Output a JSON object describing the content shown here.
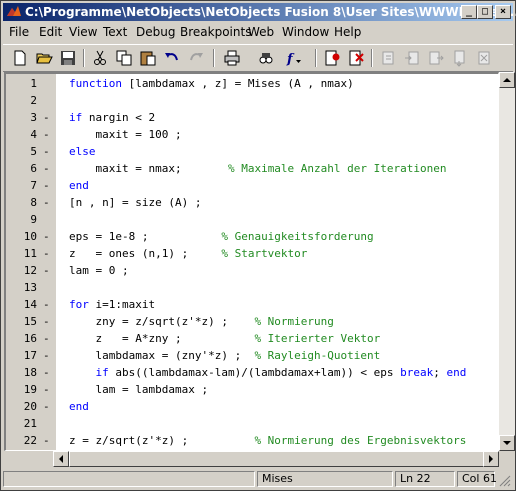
{
  "window": {
    "title": "C:\\Programme\\NetObjects\\NetObjects Fusion 8\\User Sites\\WWWErgVert...",
    "controls": [
      "_",
      "□",
      "×"
    ]
  },
  "menu": [
    "File",
    "Edit",
    "View",
    "Text",
    "Debug",
    "Breakpoints",
    "Web",
    "Window",
    "Help"
  ],
  "toolbar": [
    "new-icon",
    "open-icon",
    "save-icon",
    "cut-icon",
    "copy-icon",
    "paste-icon",
    "undo-icon",
    "redo-icon",
    "print-icon",
    "find-icon",
    "function-icon",
    "set-breakpoint-icon",
    "clear-breakpoints-icon",
    "step-icon",
    "step-in-icon",
    "step-out-icon",
    "continue-icon",
    "exit-debug-icon"
  ],
  "editor": {
    "lines": [
      {
        "n": "1",
        "dash": "",
        "segs": [
          [
            "kw",
            "function"
          ],
          [
            "tx",
            " [lambdamax , z] = Mises (A , nmax)"
          ]
        ]
      },
      {
        "n": "2",
        "dash": "",
        "segs": []
      },
      {
        "n": "3",
        "dash": "-",
        "segs": [
          [
            "kw",
            "if"
          ],
          [
            "tx",
            " nargin < 2"
          ]
        ]
      },
      {
        "n": "4",
        "dash": "-",
        "segs": [
          [
            "tx",
            "    maxit = 100 ;"
          ]
        ]
      },
      {
        "n": "5",
        "dash": "-",
        "segs": [
          [
            "kw",
            "else"
          ]
        ]
      },
      {
        "n": "6",
        "dash": "-",
        "segs": [
          [
            "tx",
            "    maxit = nmax;       "
          ],
          [
            "cm",
            "% Maximale Anzahl der Iterationen"
          ]
        ]
      },
      {
        "n": "7",
        "dash": "-",
        "segs": [
          [
            "kw",
            "end"
          ]
        ]
      },
      {
        "n": "8",
        "dash": "-",
        "segs": [
          [
            "tx",
            "[n , n] = size (A) ;"
          ]
        ]
      },
      {
        "n": "9",
        "dash": "",
        "segs": []
      },
      {
        "n": "10",
        "dash": "-",
        "segs": [
          [
            "tx",
            "eps = 1e-8 ;           "
          ],
          [
            "cm",
            "% Genauigkeitsforderung"
          ]
        ]
      },
      {
        "n": "11",
        "dash": "-",
        "segs": [
          [
            "tx",
            "z   = ones (n,1) ;     "
          ],
          [
            "cm",
            "% Startvektor"
          ]
        ]
      },
      {
        "n": "12",
        "dash": "-",
        "segs": [
          [
            "tx",
            "lam = 0 ;"
          ]
        ]
      },
      {
        "n": "13",
        "dash": "",
        "segs": []
      },
      {
        "n": "14",
        "dash": "-",
        "segs": [
          [
            "kw",
            "for"
          ],
          [
            "tx",
            " i=1:maxit"
          ]
        ]
      },
      {
        "n": "15",
        "dash": "-",
        "segs": [
          [
            "tx",
            "    zny = z/sqrt(z'*z) ;    "
          ],
          [
            "cm",
            "% Normierung"
          ]
        ]
      },
      {
        "n": "16",
        "dash": "-",
        "segs": [
          [
            "tx",
            "    z   = A*zny ;           "
          ],
          [
            "cm",
            "% Iterierter Vektor"
          ]
        ]
      },
      {
        "n": "17",
        "dash": "-",
        "segs": [
          [
            "tx",
            "    lambdamax = (zny'*z) ;  "
          ],
          [
            "cm",
            "% Rayleigh-Quotient"
          ]
        ]
      },
      {
        "n": "18",
        "dash": "-",
        "segs": [
          [
            "tx",
            "    "
          ],
          [
            "kw",
            "if"
          ],
          [
            "tx",
            " abs((lambdamax-lam)/(lambdamax+lam)) < eps "
          ],
          [
            "kw",
            "break"
          ],
          [
            "tx",
            "; "
          ],
          [
            "kw",
            "end"
          ]
        ]
      },
      {
        "n": "19",
        "dash": "-",
        "segs": [
          [
            "tx",
            "    lam = lambdamax ;"
          ]
        ]
      },
      {
        "n": "20",
        "dash": "-",
        "segs": [
          [
            "kw",
            "end"
          ]
        ]
      },
      {
        "n": "21",
        "dash": "",
        "segs": []
      },
      {
        "n": "22",
        "dash": "-",
        "segs": [
          [
            "tx",
            "z = z/sqrt(z'*z) ;          "
          ],
          [
            "cm",
            "% Normierung des Ergebnisvektors"
          ]
        ]
      }
    ]
  },
  "status": {
    "function_name": "Mises",
    "line": "Ln 22",
    "col": "Col 61"
  }
}
